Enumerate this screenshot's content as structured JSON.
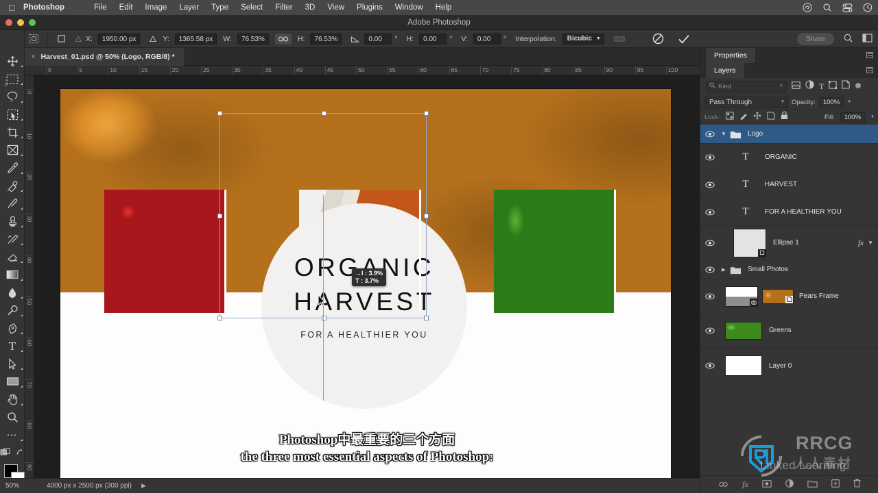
{
  "macbar": {
    "apple_icon": "apple-icon",
    "app_name": "Photoshop",
    "menus": [
      "File",
      "Edit",
      "Image",
      "Layer",
      "Type",
      "Select",
      "Filter",
      "3D",
      "View",
      "Plugins",
      "Window",
      "Help"
    ],
    "right_icons": [
      "creative-cloud-icon",
      "search-icon",
      "control-center-icon",
      "clock-icon"
    ]
  },
  "titlebar": {
    "title": "Adobe Photoshop"
  },
  "options": {
    "home_icon": "home-icon",
    "preset_icon": "tool-preset-icon",
    "reference_point_icon": "reference-point-icon",
    "x_label": "X:",
    "x_value": "1950.00 px",
    "delta_icon": "delta-icon",
    "y_label": "Y:",
    "y_value": "1365.58 px",
    "w_label": "W:",
    "w_value": "76.53%",
    "link_icon": "chain-link-icon",
    "h_label": "H:",
    "h_value": "76.53%",
    "angle_icon": "angle-icon",
    "angle_value": "0.00",
    "degree": "°",
    "skew_h_label": "H:",
    "skew_h_value": "0.00",
    "skew_v_label": "V:",
    "skew_v_value": "0.00",
    "interpolation_label": "Interpolation:",
    "interpolation_value": "Bicubic",
    "warp_icon": "warp-icon",
    "cancel_icon": "cancel-transform-icon",
    "commit_icon": "commit-transform-icon",
    "share_label": "Share",
    "search_icon": "search-icon",
    "workspace_icon": "workspace-switcher-icon"
  },
  "tab": {
    "close_icon": "close-tab-icon",
    "title": "Harvest_01.psd @ 50% (Logo, RGB/8) *"
  },
  "toolbar": {
    "tools": [
      {
        "name": "move-tool",
        "icon": "move-icon"
      },
      {
        "name": "rectangular-marquee-tool",
        "icon": "marquee-icon"
      },
      {
        "name": "lasso-tool",
        "icon": "lasso-icon"
      },
      {
        "name": "object-selection-tool",
        "icon": "object-selection-icon"
      },
      {
        "name": "crop-tool",
        "icon": "crop-icon"
      },
      {
        "name": "frame-tool",
        "icon": "frame-icon"
      },
      {
        "name": "eyedropper-tool",
        "icon": "eyedropper-icon"
      },
      {
        "name": "spot-healing-brush-tool",
        "icon": "healing-brush-icon"
      },
      {
        "name": "brush-tool",
        "icon": "brush-icon"
      },
      {
        "name": "clone-stamp-tool",
        "icon": "clone-stamp-icon"
      },
      {
        "name": "history-brush-tool",
        "icon": "history-brush-icon"
      },
      {
        "name": "eraser-tool",
        "icon": "eraser-icon"
      },
      {
        "name": "gradient-tool",
        "icon": "gradient-icon"
      },
      {
        "name": "blur-tool",
        "icon": "blur-drop-icon"
      },
      {
        "name": "dodge-tool",
        "icon": "dodge-icon"
      },
      {
        "name": "pen-tool",
        "icon": "pen-icon"
      },
      {
        "name": "type-tool",
        "icon": "type-icon"
      },
      {
        "name": "path-selection-tool",
        "icon": "path-selection-arrow-icon"
      },
      {
        "name": "rectangle-tool",
        "icon": "rectangle-icon"
      },
      {
        "name": "hand-tool",
        "icon": "hand-icon"
      },
      {
        "name": "zoom-tool",
        "icon": "zoom-magnifier-icon"
      },
      {
        "name": "edit-toolbar-button",
        "icon": "ellipsis-icon"
      }
    ],
    "quick_mask_icon": "quick-mask-icon",
    "screen_mode_icon": "screen-mode-icon",
    "foreground_color": "#000000",
    "background_color": "#ffffff"
  },
  "rulers": {
    "horizontal": [
      "0",
      "5",
      "10",
      "15",
      "20",
      "25",
      "30",
      "35",
      "40",
      "45",
      "50",
      "55",
      "60",
      "65",
      "70",
      "75",
      "80",
      "85",
      "90",
      "95",
      "100"
    ],
    "vertical": [
      "0",
      "10",
      "20",
      "30",
      "40",
      "50",
      "60",
      "70",
      "80",
      "90"
    ]
  },
  "canvas": {
    "logo": {
      "line1": "ORGANIC",
      "line2": "HARVEST",
      "line3": "FOR A HEALTHIER YOU"
    },
    "transform_tip": {
      "horizontal": "→l : 3.9%",
      "vertical": "T : 3.7%"
    }
  },
  "subtitles": {
    "line1": "Photoshop中最重要的三个方面",
    "line2": "the three most essential aspects of Photoshop:"
  },
  "panels": {
    "properties_tab": "Properties",
    "layers_tab": "Layers",
    "menu_icon": "panel-menu-icon",
    "filter": {
      "search_icon": "search-icon",
      "kind_label": "Kind",
      "chevron_icon": "chevron-down-icon",
      "type_filters": [
        "pixel-filter-icon",
        "adjustment-filter-icon",
        "type-filter-icon",
        "shape-filter-icon",
        "smart-object-filter-icon"
      ],
      "toggle_icon": "filter-toggle-icon"
    },
    "blend_mode": "Pass Through",
    "opacity_label": "Opacity:",
    "opacity_value": "100%",
    "lock_label": "Lock:",
    "lock_icons": [
      "lock-transparent-pixels-icon",
      "lock-image-pixels-icon",
      "lock-position-icon",
      "lock-artboard-icon",
      "lock-all-icon"
    ],
    "fill_label": "Fill:",
    "fill_value": "100%",
    "layers": [
      {
        "name": "Logo",
        "type": "group",
        "selected": true,
        "expanded": true,
        "visible": true,
        "fx": false
      },
      {
        "name": "ORGANIC",
        "type": "text",
        "selected": false,
        "visible": true,
        "fx": false
      },
      {
        "name": "HARVEST",
        "type": "text",
        "selected": false,
        "visible": true,
        "fx": false
      },
      {
        "name": "FOR A HEALTHIER YOU",
        "type": "text",
        "selected": false,
        "visible": true,
        "fx": false
      },
      {
        "name": "Ellipse 1",
        "type": "shape",
        "selected": false,
        "visible": true,
        "fx": true,
        "fx_label": "fx"
      },
      {
        "name": "Small Photos",
        "type": "group",
        "selected": false,
        "expanded": false,
        "visible": true,
        "fx": false
      },
      {
        "name": "Pears Frame",
        "type": "smart-object-mask",
        "selected": false,
        "visible": true,
        "fx": false
      },
      {
        "name": "Greens",
        "type": "pixel-green",
        "selected": false,
        "visible": true,
        "fx": false
      },
      {
        "name": "Layer 0",
        "type": "pixel-white",
        "selected": false,
        "visible": true,
        "fx": false
      }
    ],
    "bottom_icons": [
      "link-layers-icon",
      "add-layer-style-icon",
      "add-layer-mask-icon",
      "new-adjustment-layer-icon",
      "new-group-icon",
      "new-layer-icon",
      "delete-layer-icon"
    ]
  },
  "statusbar": {
    "zoom": "50%",
    "dimensions": "4000 px x 2500 px (300 ppi)",
    "chevron_icon": "chevron-right-icon"
  },
  "watermarks": {
    "linkedin": "Linked    Learning",
    "rrcg": "RRCG",
    "chinese": "人人素材"
  },
  "colors": {
    "accent_selected": "#2f5a86",
    "panel_bg": "#353535",
    "canvas_bg": "#1e1e1e",
    "smart_guide": "#ff64e0"
  }
}
